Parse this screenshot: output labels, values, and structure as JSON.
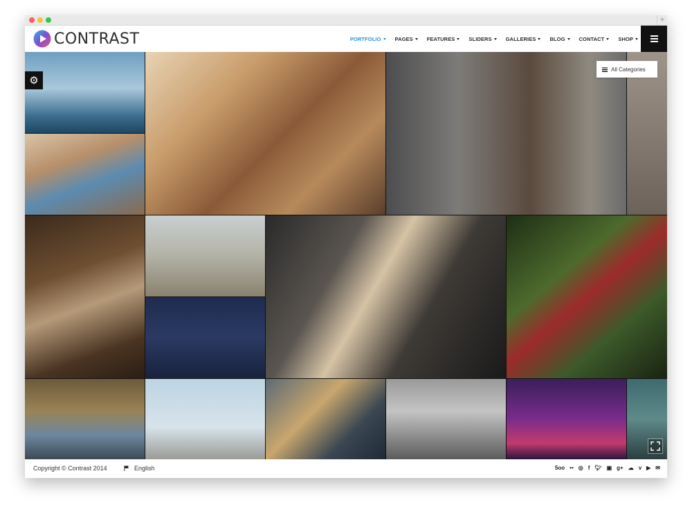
{
  "window": {
    "traffic_lights": [
      "#fc605c",
      "#fdbc40",
      "#34c84a"
    ],
    "new_tab": "+"
  },
  "header": {
    "logo_text": "CONTRAST",
    "nav": [
      {
        "label": "PORTFOLIO",
        "active": true
      },
      {
        "label": "PAGES"
      },
      {
        "label": "FEATURES"
      },
      {
        "label": "SLIDERS"
      },
      {
        "label": "GALLERIES"
      },
      {
        "label": "BLOG"
      },
      {
        "label": "CONTACT"
      },
      {
        "label": "SHOP"
      }
    ],
    "accent_color": "#2a8fe0"
  },
  "portfolio": {
    "filter_label": "All Categories",
    "settings_icon": "gear-icon",
    "fullscreen_icon": "fullscreen-icon"
  },
  "footer": {
    "copyright": "Copyright © Contrast 2014",
    "language": "English",
    "social": [
      "500px-icon",
      "flickr-icon",
      "dribbble-icon",
      "facebook-icon",
      "twitter-icon",
      "instagram-icon",
      "google-plus-icon",
      "soundcloud-icon",
      "vimeo-icon",
      "youtube-icon",
      "email-icon"
    ]
  }
}
